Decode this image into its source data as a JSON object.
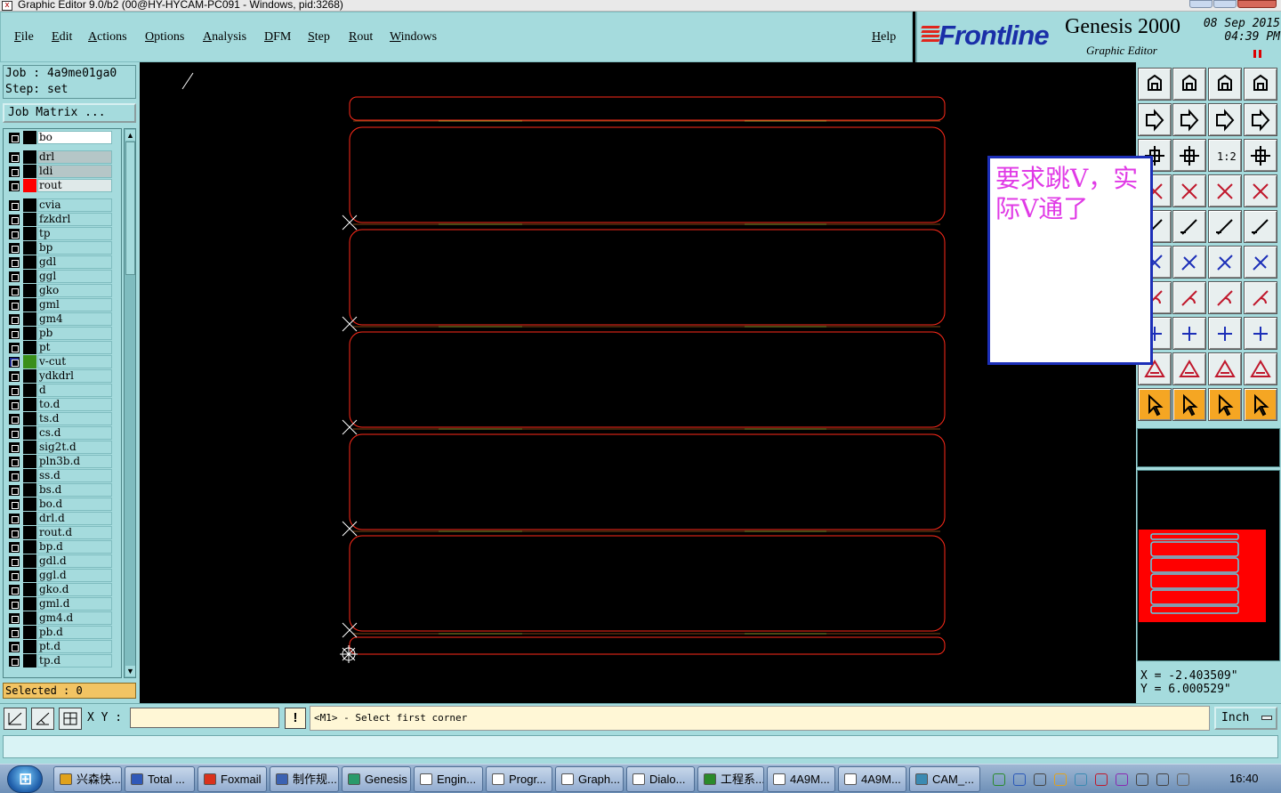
{
  "window": {
    "title": "Graphic Editor 9.0/b2 (00@HY-HYCAM-PC091 - Windows, pid:3268)"
  },
  "menu": [
    {
      "label": "File"
    },
    {
      "label": "Edit"
    },
    {
      "label": "Actions"
    },
    {
      "label": "Options"
    },
    {
      "label": "Analysis"
    },
    {
      "label": "DFM"
    },
    {
      "label": "Step"
    },
    {
      "label": "Rout"
    },
    {
      "label": "Windows"
    },
    {
      "label": "Help"
    }
  ],
  "logo": {
    "brand": "Frontline",
    "product": "Genesis 2000",
    "subtitle": "Graphic Editor",
    "date_line1": "08 Sep 2015",
    "date_line2": "04:39 PM"
  },
  "job_info": {
    "job_label": "Job : ",
    "job_value": "4a9me01ga0",
    "step_label": "Step: ",
    "step_value": "set"
  },
  "job_matrix_label": "Job Matrix ...",
  "layers": [
    {
      "name": "bo",
      "color": "#000000",
      "highlight": "white",
      "flag": ""
    },
    {
      "name": "drl",
      "color": "#000000",
      "highlight": "gray",
      "flag": ""
    },
    {
      "name": "ldi",
      "color": "#000000",
      "highlight": "gray",
      "flag": ""
    },
    {
      "name": "rout",
      "color": "#ff0000",
      "highlight": "light",
      "flag": ""
    },
    {
      "name": "cvia",
      "color": "#000000",
      "highlight": "",
      "flag": ""
    },
    {
      "name": "fzkdrl",
      "color": "#000000",
      "highlight": "",
      "flag": ""
    },
    {
      "name": "tp",
      "color": "#000000",
      "highlight": "",
      "flag": ""
    },
    {
      "name": "bp",
      "color": "#000000",
      "highlight": "",
      "flag": ""
    },
    {
      "name": "gdl",
      "color": "#000000",
      "highlight": "",
      "flag": ""
    },
    {
      "name": "ggl",
      "color": "#000000",
      "highlight": "",
      "flag": ""
    },
    {
      "name": "gko",
      "color": "#000000",
      "highlight": "",
      "flag": ""
    },
    {
      "name": "gml",
      "color": "#000000",
      "highlight": "",
      "flag": ""
    },
    {
      "name": "gm4",
      "color": "#000000",
      "highlight": "",
      "flag": ""
    },
    {
      "name": "pb",
      "color": "#000000",
      "highlight": "",
      "flag": ""
    },
    {
      "name": "pt",
      "color": "#000000",
      "highlight": "",
      "flag": ""
    },
    {
      "name": "v-cut",
      "color": "#3a8f1a",
      "highlight": "",
      "flag": "▫",
      "active": true
    },
    {
      "name": "ydkdrl",
      "color": "#000000",
      "highlight": "",
      "flag": ""
    },
    {
      "name": "d",
      "color": "#000000",
      "highlight": "",
      "flag": ""
    },
    {
      "name": "to.d",
      "color": "#000000",
      "highlight": "",
      "flag": "✎"
    },
    {
      "name": "ts.d",
      "color": "#000000",
      "highlight": "",
      "flag": ""
    },
    {
      "name": "cs.d",
      "color": "#000000",
      "highlight": "",
      "flag": "✎"
    },
    {
      "name": "sig2t.d",
      "color": "#000000",
      "highlight": "",
      "flag": "✎"
    },
    {
      "name": "pln3b.d",
      "color": "#000000",
      "highlight": "",
      "flag": "✎"
    },
    {
      "name": "ss.d",
      "color": "#000000",
      "highlight": "",
      "flag": "✎"
    },
    {
      "name": "bs.d",
      "color": "#000000",
      "highlight": "",
      "flag": ""
    },
    {
      "name": "bo.d",
      "color": "#000000",
      "highlight": "",
      "flag": "✎"
    },
    {
      "name": "drl.d",
      "color": "#000000",
      "highlight": "",
      "flag": ""
    },
    {
      "name": "rout.d",
      "color": "#000000",
      "highlight": "",
      "flag": ""
    },
    {
      "name": "bp.d",
      "color": "#000000",
      "highlight": "",
      "flag": ""
    },
    {
      "name": "gdl.d",
      "color": "#000000",
      "highlight": "",
      "flag": "✎"
    },
    {
      "name": "ggl.d",
      "color": "#000000",
      "highlight": "",
      "flag": ""
    },
    {
      "name": "gko.d",
      "color": "#000000",
      "highlight": "",
      "flag": ""
    },
    {
      "name": "gml.d",
      "color": "#000000",
      "highlight": "",
      "flag": "✎"
    },
    {
      "name": "gm4.d",
      "color": "#000000",
      "highlight": "",
      "flag": "✎"
    },
    {
      "name": "pb.d",
      "color": "#000000",
      "highlight": "",
      "flag": ""
    },
    {
      "name": "pt.d",
      "color": "#000000",
      "highlight": "",
      "flag": ""
    },
    {
      "name": "tp.d",
      "color": "#000000",
      "highlight": "",
      "flag": ""
    }
  ],
  "selected_text": "Selected : 0",
  "note_text": "要求跳V，实际V通了",
  "coords": {
    "x_line": "X = -2.403509\"",
    "y_line": "Y = 6.000529\""
  },
  "toolbar_ratio_label": "1:2",
  "command": {
    "xy_label": "X Y :",
    "xy_value": "",
    "excl": "!",
    "prompt": "<M1> - Select first corner",
    "unit": "Inch"
  },
  "taskbar": {
    "items": [
      {
        "label": "兴森快...",
        "icon": "star-icon",
        "color": "#e0a21d"
      },
      {
        "label": "Total ...",
        "icon": "disk-icon",
        "color": "#2f58b8"
      },
      {
        "label": "Foxmail",
        "icon": "fox-icon",
        "color": "#d9321c"
      },
      {
        "label": "制作规...",
        "icon": "doc-icon",
        "color": "#3b62b2"
      },
      {
        "label": "Genesis",
        "icon": "genesis-icon",
        "color": "#2a9a6a"
      },
      {
        "label": "Engin...",
        "icon": "window-icon",
        "color": "#ffffff"
      },
      {
        "label": "Progr...",
        "icon": "window-icon",
        "color": "#ffffff"
      },
      {
        "label": "Graph...",
        "icon": "window-icon",
        "color": "#ffffff"
      },
      {
        "label": "Dialo...",
        "icon": "window-icon",
        "color": "#ffffff"
      },
      {
        "label": "工程系...",
        "icon": "f-icon",
        "color": "#2a8a2a"
      },
      {
        "label": "4A9M...",
        "icon": "window-icon",
        "color": "#ffffff"
      },
      {
        "label": "4A9M...",
        "icon": "window-icon",
        "color": "#ffffff"
      },
      {
        "label": "CAM_...",
        "icon": "cam-icon",
        "color": "#3b8ab2"
      }
    ],
    "clock": "16:40"
  }
}
